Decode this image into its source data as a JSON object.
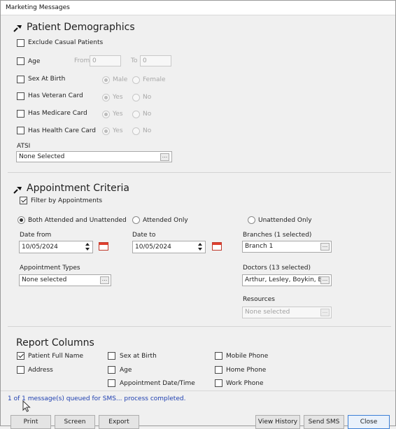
{
  "window": {
    "title": "Marketing Messages"
  },
  "demographics": {
    "title": "Patient Demographics",
    "exclude_casual": "Exclude Casual Patients",
    "age": {
      "label": "Age",
      "from_label": "From",
      "from_value": "0",
      "to_label": "To",
      "to_value": "0"
    },
    "sex": {
      "label": "Sex At Birth",
      "opt1": "Male",
      "opt2": "Female"
    },
    "veteran": {
      "label": "Has Veteran Card",
      "opt1": "Yes",
      "opt2": "No"
    },
    "medicare": {
      "label": "Has Medicare Card",
      "opt1": "Yes",
      "opt2": "No"
    },
    "healthcare": {
      "label": "Has Health Care Card",
      "opt1": "Yes",
      "opt2": "No"
    },
    "atsi": {
      "label": "ATSI",
      "value": "None Selected",
      "browse": "..."
    }
  },
  "appointments": {
    "title": "Appointment Criteria",
    "filter": "Filter by Appointments",
    "radio_both": "Both Attended and Unattended",
    "radio_attended": "Attended Only",
    "radio_unattended": "Unattended Only",
    "date_from_label": "Date from",
    "date_from_value": "10/05/2024",
    "date_to_label": "Date to",
    "date_to_value": "10/05/2024",
    "branches_label": "Branches (1 selected)",
    "branches_value": "Branch 1",
    "types_label": "Appointment Types",
    "types_value": "None selected",
    "doctors_label": "Doctors (13 selected)",
    "doctors_value": "Arthur, Lesley, Boykin, E",
    "resources_label": "Resources",
    "resources_value": "None selected",
    "browse": "..."
  },
  "report_columns": {
    "title": "Report Columns",
    "patient_full_name": "Patient Full Name",
    "address": "Address",
    "sex_at_birth": "Sex at Birth",
    "age": "Age",
    "appt_datetime": "Appointment Date/Time",
    "mobile_phone": "Mobile Phone",
    "home_phone": "Home Phone",
    "work_phone": "Work Phone"
  },
  "status": "1 of 1 message(s) queued for SMS... process completed.",
  "buttons": {
    "print": "Print",
    "screen": "Screen",
    "export": "Export",
    "view_history": "View History",
    "send_sms": "Send SMS",
    "close": "Close"
  }
}
